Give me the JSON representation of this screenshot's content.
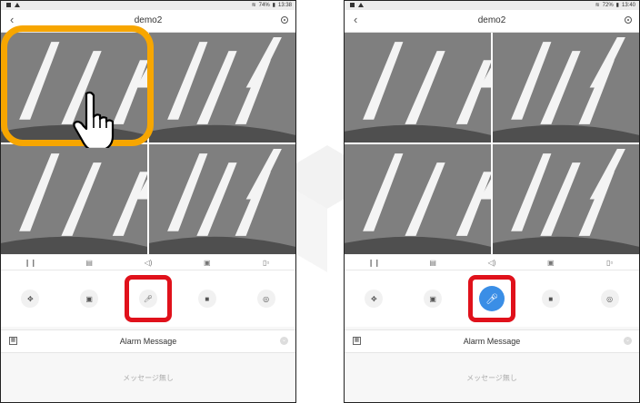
{
  "status_left": {
    "time": "13:38",
    "battery": "74%"
  },
  "status_right": {
    "time": "13:40",
    "battery": "72%"
  },
  "title": "demo2",
  "toolbar_icons": [
    "pause-icon",
    "layout-icon",
    "volume-icon",
    "screen-icon",
    "split-icon"
  ],
  "toolbar_glyphs": [
    "❙❙",
    "▤",
    "◁)",
    "▣",
    "▯▫"
  ],
  "controls": [
    {
      "name": "ptz-button",
      "icon": "ptz-icon",
      "glyph": "✥"
    },
    {
      "name": "snapshot-button",
      "icon": "camera-icon",
      "glyph": "▣"
    },
    {
      "name": "microphone-button",
      "icon": "microphone-icon",
      "glyph": "🎙"
    },
    {
      "name": "record-button",
      "icon": "video-record-icon",
      "glyph": "■"
    },
    {
      "name": "fisheye-button",
      "icon": "fisheye-icon",
      "glyph": "◎"
    }
  ],
  "alarm": {
    "label": "Alarm Message",
    "empty_text": "メッセージ無し"
  },
  "colors": {
    "highlight_orange": "#f7a600",
    "highlight_red": "#e0111b",
    "mic_active": "#3a8ee6"
  }
}
